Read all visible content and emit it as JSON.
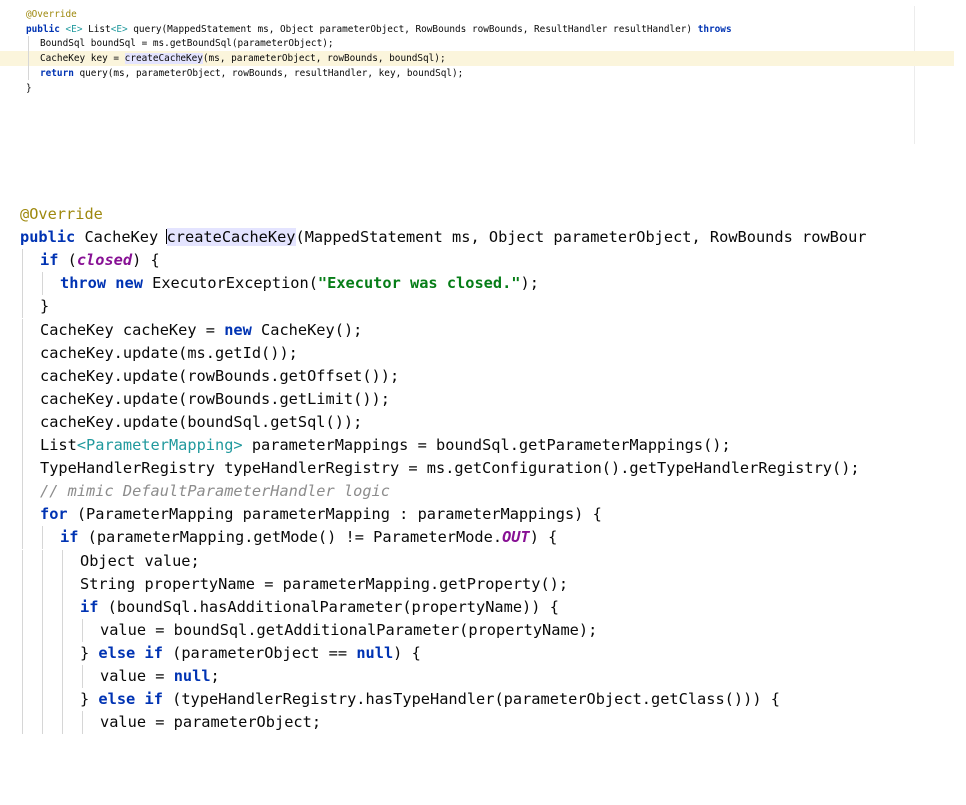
{
  "snippet1": {
    "lines": [
      {
        "indent": 0,
        "tokens": [
          {
            "t": "@Override",
            "c": "ann"
          }
        ]
      },
      {
        "indent": 0,
        "tokens": [
          {
            "t": "public",
            "c": "kw"
          },
          {
            "t": " "
          },
          {
            "t": "<E>",
            "c": "gen"
          },
          {
            "t": " List"
          },
          {
            "t": "<E>",
            "c": "gen"
          },
          {
            "t": " query(MappedStatement ms, Object parameterObject, RowBounds rowBounds, ResultHandler resultHandler) "
          },
          {
            "t": "throws",
            "c": "kw"
          }
        ]
      },
      {
        "indent": 1,
        "tokens": [
          {
            "t": "BoundSql boundSql = ms.getBoundSql(parameterObject);"
          }
        ]
      },
      {
        "indent": 1,
        "highlight": true,
        "tokens": [
          {
            "t": "CacheKey key = "
          },
          {
            "t": "createCach",
            "c": "usage"
          },
          {
            "t": "",
            "caret": true
          },
          {
            "t": "eKey",
            "c": "usage"
          },
          {
            "t": "(ms, parameterObject, rowBounds, boundSql);"
          }
        ]
      },
      {
        "indent": 1,
        "tokens": [
          {
            "t": "return",
            "c": "kw"
          },
          {
            "t": " query(ms, parameterObject, rowBounds, resultHandler, key, boundSql);"
          }
        ]
      },
      {
        "indent": 0,
        "tokens": [
          {
            "t": "}"
          }
        ]
      }
    ]
  },
  "snippet2": {
    "lines": [
      {
        "indent": 0,
        "tokens": [
          {
            "t": "@Override",
            "c": "ann"
          }
        ]
      },
      {
        "indent": 0,
        "tokens": [
          {
            "t": "public",
            "c": "kw"
          },
          {
            "t": " CacheKey "
          },
          {
            "t": "",
            "caret": true
          },
          {
            "t": "createCacheKey",
            "c": "usage"
          },
          {
            "t": "(MappedStatement ms, Object parameterObject, RowBounds rowBour"
          }
        ]
      },
      {
        "indent": 1,
        "tokens": [
          {
            "t": "if",
            "c": "kw"
          },
          {
            "t": " ("
          },
          {
            "t": "closed",
            "c": "enum"
          },
          {
            "t": ") {"
          }
        ]
      },
      {
        "indent": 2,
        "tokens": [
          {
            "t": "throw",
            "c": "kw"
          },
          {
            "t": " "
          },
          {
            "t": "new",
            "c": "kw"
          },
          {
            "t": " ExecutorException("
          },
          {
            "t": "\"Executor was closed.\"",
            "c": "str"
          },
          {
            "t": ");"
          }
        ]
      },
      {
        "indent": 1,
        "tokens": [
          {
            "t": "}"
          }
        ]
      },
      {
        "indent": 1,
        "tokens": [
          {
            "t": "CacheKey cacheKey = "
          },
          {
            "t": "new",
            "c": "kw"
          },
          {
            "t": " CacheKey();"
          }
        ]
      },
      {
        "indent": 1,
        "tokens": [
          {
            "t": "cacheKey.update(ms.getId());"
          }
        ]
      },
      {
        "indent": 1,
        "tokens": [
          {
            "t": "cacheKey.update(rowBounds.getOffset());"
          }
        ]
      },
      {
        "indent": 1,
        "tokens": [
          {
            "t": "cacheKey.update(rowBounds.getLimit());"
          }
        ]
      },
      {
        "indent": 1,
        "tokens": [
          {
            "t": "cacheKey.update(boundSql.getSql());"
          }
        ]
      },
      {
        "indent": 1,
        "tokens": [
          {
            "t": "List"
          },
          {
            "t": "<ParameterMapping>",
            "c": "gen"
          },
          {
            "t": " parameterMappings = boundSql.getParameterMappings();"
          }
        ]
      },
      {
        "indent": 1,
        "tokens": [
          {
            "t": "TypeHandlerRegistry typeHandlerRegistry = ms.getConfiguration().getTypeHandlerRegistry();"
          }
        ]
      },
      {
        "indent": 1,
        "tokens": [
          {
            "t": "// mimic DefaultParameterHandler logic",
            "c": "cmt"
          }
        ]
      },
      {
        "indent": 1,
        "tokens": [
          {
            "t": "for",
            "c": "kw"
          },
          {
            "t": " (ParameterMapping parameterMapping : parameterMappings) {"
          }
        ]
      },
      {
        "indent": 2,
        "tokens": [
          {
            "t": "if",
            "c": "kw"
          },
          {
            "t": " (parameterMapping.getMode() != ParameterMode."
          },
          {
            "t": "OUT",
            "c": "enum"
          },
          {
            "t": ") {"
          }
        ]
      },
      {
        "indent": 3,
        "tokens": [
          {
            "t": "Object value;"
          }
        ]
      },
      {
        "indent": 3,
        "tokens": [
          {
            "t": "String propertyName = parameterMapping.getProperty();"
          }
        ]
      },
      {
        "indent": 3,
        "tokens": [
          {
            "t": "if",
            "c": "kw"
          },
          {
            "t": " (boundSql.hasAdditionalParameter(propertyName)) {"
          }
        ]
      },
      {
        "indent": 4,
        "tokens": [
          {
            "t": "value = boundSql.getAdditionalParameter(propertyName);"
          }
        ]
      },
      {
        "indent": 3,
        "tokens": [
          {
            "t": "} "
          },
          {
            "t": "else",
            "c": "kw"
          },
          {
            "t": " "
          },
          {
            "t": "if",
            "c": "kw"
          },
          {
            "t": " (parameterObject == "
          },
          {
            "t": "null",
            "c": "kw"
          },
          {
            "t": ") {"
          }
        ]
      },
      {
        "indent": 4,
        "tokens": [
          {
            "t": "value = "
          },
          {
            "t": "null",
            "c": "kw"
          },
          {
            "t": ";"
          }
        ]
      },
      {
        "indent": 3,
        "tokens": [
          {
            "t": "} "
          },
          {
            "t": "else",
            "c": "kw"
          },
          {
            "t": " "
          },
          {
            "t": "if",
            "c": "kw"
          },
          {
            "t": " (typeHandlerRegistry.hasTypeHandler(parameterObject.getClass())) {"
          }
        ]
      },
      {
        "indent": 4,
        "tokens": [
          {
            "t": "value = parameterObject;"
          }
        ]
      }
    ]
  }
}
